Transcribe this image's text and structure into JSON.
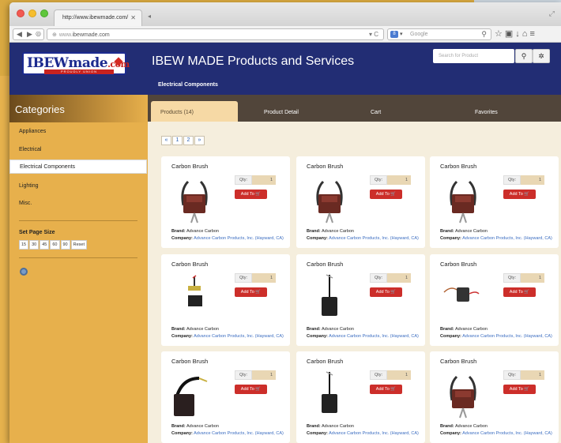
{
  "browser": {
    "tab_title": "http://www.ibewmade.com/",
    "url_scheme": "www.",
    "url_domain": "ibewmade.com",
    "search_placeholder": "Google",
    "search_engine_badge": "8"
  },
  "site": {
    "logo_main": "IBEWmade",
    "logo_tld": ".com",
    "logo_tagline": "PROUDLY UNION",
    "title": "IBEW MADE Products and Services",
    "subtitle": "Electrical Components",
    "search_placeholder": "Search for Product"
  },
  "sidebar": {
    "heading": "Categories",
    "items": [
      {
        "label": "Appliances"
      },
      {
        "label": "Electrical"
      },
      {
        "label": "Electrical Components"
      },
      {
        "label": "Lighting"
      },
      {
        "label": "Misc."
      }
    ],
    "page_size_label": "Set Page Size",
    "page_sizes": [
      "15",
      "30",
      "45",
      "60",
      "90",
      "Reset"
    ]
  },
  "tabs": [
    "Products (14)",
    "Product Detail",
    "Cart",
    "Favorites"
  ],
  "pager": [
    "«",
    "1",
    "2",
    "»"
  ],
  "product_fields": {
    "qty_label": "Qty:",
    "add_label": "Add To 🛒",
    "brand_label": "Brand:",
    "company_label": "Company:"
  },
  "products": [
    {
      "title": "Carbon Brush",
      "qty": "1",
      "brand": "Advance Carbon",
      "company": "Advance Carbon Products, Inc. (Hayward, CA)"
    },
    {
      "title": "Carbon Brush",
      "qty": "1",
      "brand": "Advance Carbon",
      "company": "Advance Carbon Products, Inc. (Hayward, CA)"
    },
    {
      "title": "Carbon Brush",
      "qty": "1",
      "brand": "Advance Carbon",
      "company": "Advance Carbon Products, Inc. (Hayward, CA)"
    },
    {
      "title": "Carbon Brush",
      "qty": "1",
      "brand": "Advance Carbon",
      "company": "Advance Carbon Products, Inc. (Hayward, CA)"
    },
    {
      "title": "Carbon Brush",
      "qty": "1",
      "brand": "Advance Carbon",
      "company": "Advance Carbon Products, Inc. (Hayward, CA)"
    },
    {
      "title": "Carbon Brush",
      "qty": "1",
      "brand": "Advance Carbon",
      "company": "Advance Carbon Products, Inc. (Hayward, CA)"
    },
    {
      "title": "Carbon Brush",
      "qty": "1",
      "brand": "Advance Carbon",
      "company": "Advance Carbon Products, Inc. (Hayward, CA)"
    },
    {
      "title": "Carbon Brush",
      "qty": "1",
      "brand": "Advance Carbon",
      "company": "Advance Carbon Products, Inc. (Hayward, CA)"
    },
    {
      "title": "Carbon Brush",
      "qty": "1",
      "brand": "Advance Carbon",
      "company": "Advance Carbon Products, Inc. (Hayward, CA)"
    }
  ],
  "colors": {
    "header_blue": "#222d74",
    "sidebar_gold": "#e7b04c",
    "add_button_red": "#cc2e2a",
    "link_blue": "#3a6cc0"
  }
}
